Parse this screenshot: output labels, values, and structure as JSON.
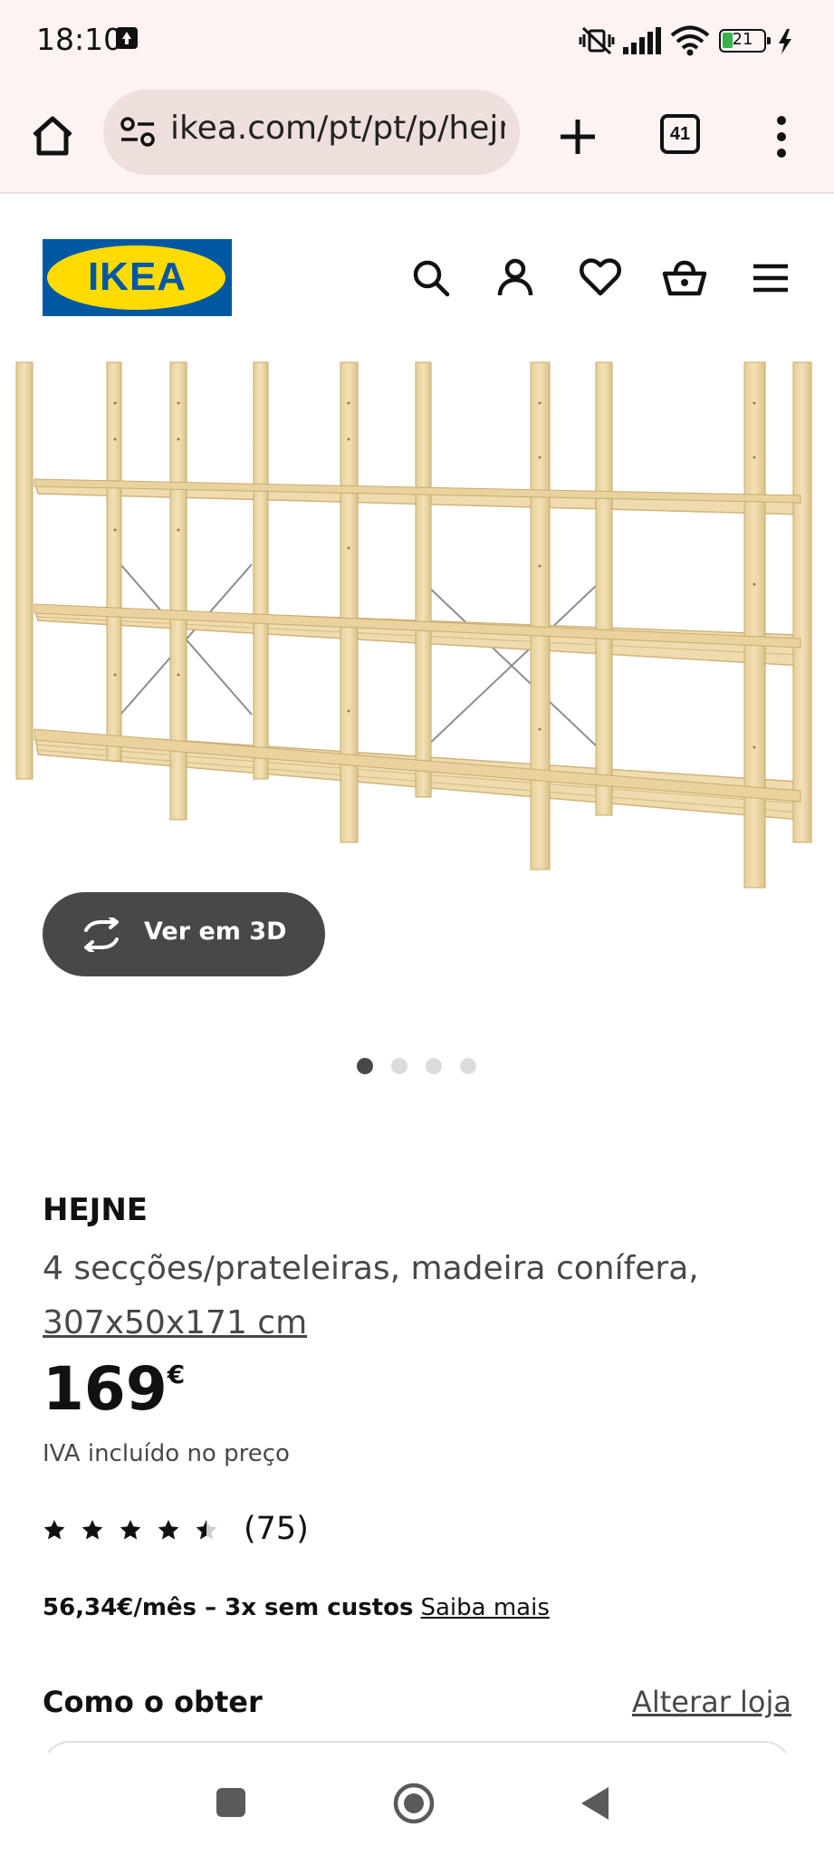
{
  "status_bar": {
    "time": "18:10",
    "battery": "21"
  },
  "browser": {
    "url": "ikea.com/pt/pt/p/hejne",
    "tab_count": "41"
  },
  "site": {
    "logo_text": "IKEA",
    "brand_colors": {
      "blue": "#0058a3",
      "yellow": "#ffdb00"
    }
  },
  "gallery": {
    "view_3d_label": "Ver em 3D",
    "image_count": 4,
    "active_index": 0
  },
  "product": {
    "name": "HEJNE",
    "description": "4 secções/prateleiras, madeira conífera,",
    "dimensions": "307x50x171 cm",
    "price": "169",
    "currency": "€",
    "vat_note": "IVA incluído no preço",
    "rating_value": 4.5,
    "rating_max": 5,
    "review_count": "(75)",
    "finance_bold": "56,34€/mês – 3x sem custos",
    "finance_link": "Saiba mais"
  },
  "availability": {
    "title": "Como o obter",
    "change_store": "Alterar loja"
  }
}
